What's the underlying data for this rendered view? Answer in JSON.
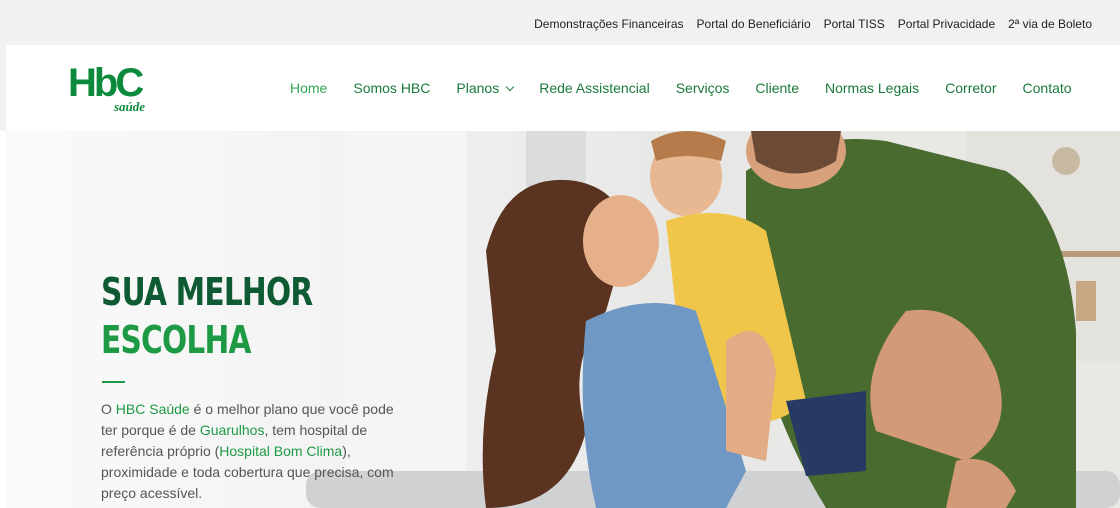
{
  "topbar": {
    "links": [
      "Demonstrações Financeiras",
      "Portal do Beneficiário",
      "Portal TISS",
      "Portal Privacidade",
      "2ª via de Boleto"
    ]
  },
  "logo": {
    "main": "HbC",
    "sub": "saúde"
  },
  "nav": {
    "items": [
      "Home",
      "Somos HBC",
      "Planos",
      "Rede Assistencial",
      "Serviços",
      "Cliente",
      "Normas Legais",
      "Corretor",
      "Contato"
    ]
  },
  "hero": {
    "headline_line1": "SUA MELHOR",
    "headline_line2": "ESCOLHA",
    "desc": {
      "p1": "O ",
      "brand": "HBC Saúde",
      "p2": " é o melhor plano que você pode ter porque é de ",
      "city": "Guarulhos",
      "p3": ", tem hospital de referência próprio (",
      "hospital": "Hospital Bom Clima",
      "p4": "), proximidade e toda cobertura que precisa, com preço acessível."
    }
  },
  "colors": {
    "brand_green": "#1e9a45",
    "dark_green": "#0e5a32",
    "topbar_bg": "#f0f2f1"
  }
}
